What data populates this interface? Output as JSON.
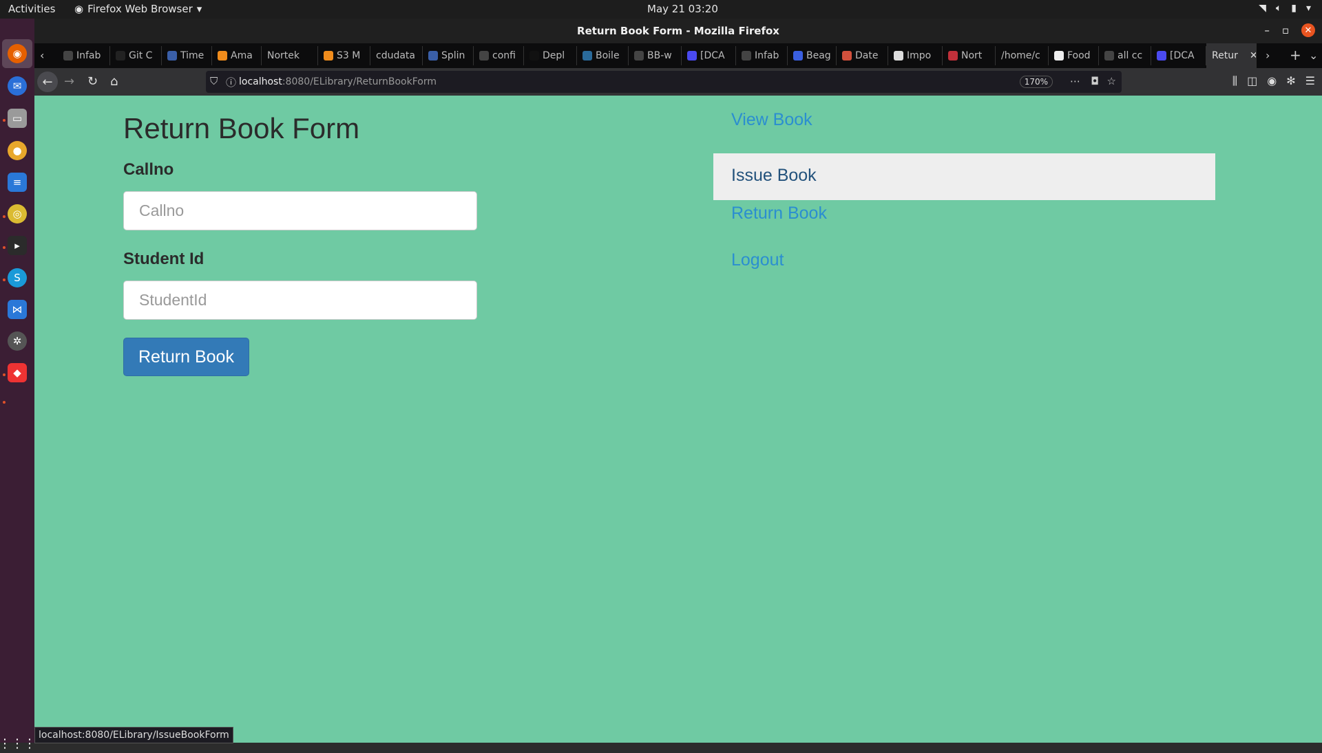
{
  "system": {
    "activities": "Activities",
    "app_menu": "Firefox Web Browser",
    "clock": "May 21  03:20"
  },
  "window": {
    "title": "Return Book Form - Mozilla Firefox"
  },
  "tabs": [
    {
      "label": "Infab",
      "fav_color": "#444"
    },
    {
      "label": "Git C",
      "fav_color": "#222"
    },
    {
      "label": "Time",
      "fav_color": "#3a5fa8"
    },
    {
      "label": "Ama",
      "fav_color": "#f08c1c"
    },
    {
      "label": "Nortek",
      "fav_color": ""
    },
    {
      "label": "S3 M",
      "fav_color": "#f08c1c"
    },
    {
      "label": "cdudata",
      "fav_color": ""
    },
    {
      "label": "Splin",
      "fav_color": "#3a5fa8"
    },
    {
      "label": "confi",
      "fav_color": "#444"
    },
    {
      "label": "Depl",
      "fav_color": "#111"
    },
    {
      "label": "Boile",
      "fav_color": "#2a6a9a"
    },
    {
      "label": "BB-w",
      "fav_color": "#444"
    },
    {
      "label": "[DCA",
      "fav_color": "#4a4af0"
    },
    {
      "label": "Infab",
      "fav_color": "#444"
    },
    {
      "label": "Beag",
      "fav_color": "#3a5fe0"
    },
    {
      "label": "Date",
      "fav_color": "#d2503c"
    },
    {
      "label": "Impo",
      "fav_color": "#ddd"
    },
    {
      "label": "Nort",
      "fav_color": "#c0303a"
    },
    {
      "label": "/home/c",
      "fav_color": ""
    },
    {
      "label": "Food",
      "fav_color": "#eee"
    },
    {
      "label": "all cc",
      "fav_color": "#444"
    },
    {
      "label": "[DCA",
      "fav_color": "#4a4af0"
    },
    {
      "label": "Retur",
      "fav_color": "",
      "active": true
    }
  ],
  "urlbar": {
    "host": "localhost",
    "path": ":8080/ELibrary/ReturnBookForm",
    "zoom": "170%"
  },
  "form": {
    "title": "Return Book Form",
    "callno_label": "Callno",
    "callno_placeholder": "Callno",
    "studentid_label": "Student Id",
    "studentid_placeholder": "StudentId",
    "submit_label": "Return Book"
  },
  "nav": {
    "items": [
      "View Book",
      "Issue Book",
      "Return Book",
      "Logout"
    ],
    "highlighted_index": 1
  },
  "status_url": "localhost:8080/ELibrary/IssueBookForm",
  "colors": {
    "page_background": "#6fcaa3",
    "link": "#2b8ed0",
    "button": "#337ab7"
  }
}
